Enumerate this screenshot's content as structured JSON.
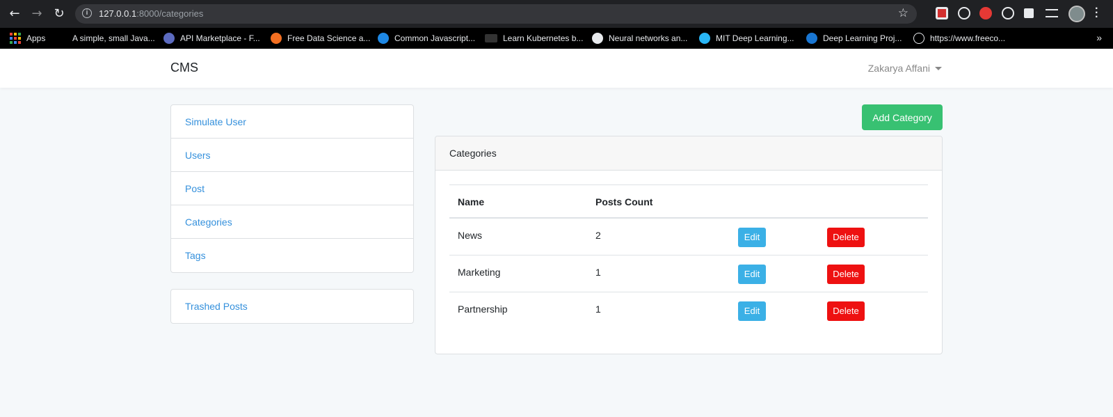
{
  "browser": {
    "url_host": "127.0.0.1",
    "url_rest": ":8000/categories",
    "bookmarks": [
      {
        "label": "Apps",
        "icon": "apps-grid-icon"
      },
      {
        "label": "A simple, small Java...",
        "icon": "none"
      },
      {
        "label": "API Marketplace - F...",
        "icon": "octopus-icon",
        "color": "#5c6bc0"
      },
      {
        "label": "Free Data Science a...",
        "icon": "cloud-icon",
        "color": "#f36f21"
      },
      {
        "label": "Common Javascript...",
        "icon": "s-logo-icon",
        "color": "#1e88e5"
      },
      {
        "label": "Learn Kubernetes b...",
        "icon": "dev-logo-icon",
        "color": "#000000"
      },
      {
        "label": "Neural networks an...",
        "icon": "globe-icon",
        "color": "#e8eaed"
      },
      {
        "label": "MIT Deep Learning...",
        "icon": "network-icon",
        "color": "#29b6f6"
      },
      {
        "label": "Deep Learning Proj...",
        "icon": "edge-icon",
        "color": "#1976d2"
      },
      {
        "label": "https://www.freeco...",
        "icon": "freecodecamp-icon",
        "color": "#e8eaed"
      }
    ],
    "more": "»"
  },
  "app": {
    "brand": "CMS",
    "user_name": "Zakarya Affani"
  },
  "sidebar": {
    "items": [
      {
        "label": "Simulate User"
      },
      {
        "label": "Users"
      },
      {
        "label": "Post"
      },
      {
        "label": "Categories"
      },
      {
        "label": "Tags"
      }
    ],
    "trash": {
      "label": "Trashed Posts"
    }
  },
  "main": {
    "add_button": "Add Category",
    "card_title": "Categories",
    "columns": [
      "Name",
      "Posts Count"
    ],
    "rows": [
      {
        "name": "News",
        "count": "2",
        "edit": "Edit",
        "delete": "Delete"
      },
      {
        "name": "Marketing",
        "count": "1",
        "edit": "Edit",
        "delete": "Delete"
      },
      {
        "name": "Partnership",
        "count": "1",
        "edit": "Edit",
        "delete": "Delete"
      }
    ]
  },
  "colors": {
    "link": "#3490dc",
    "success": "#38c172",
    "info": "#3bb0e6",
    "danger": "#ee1111"
  }
}
